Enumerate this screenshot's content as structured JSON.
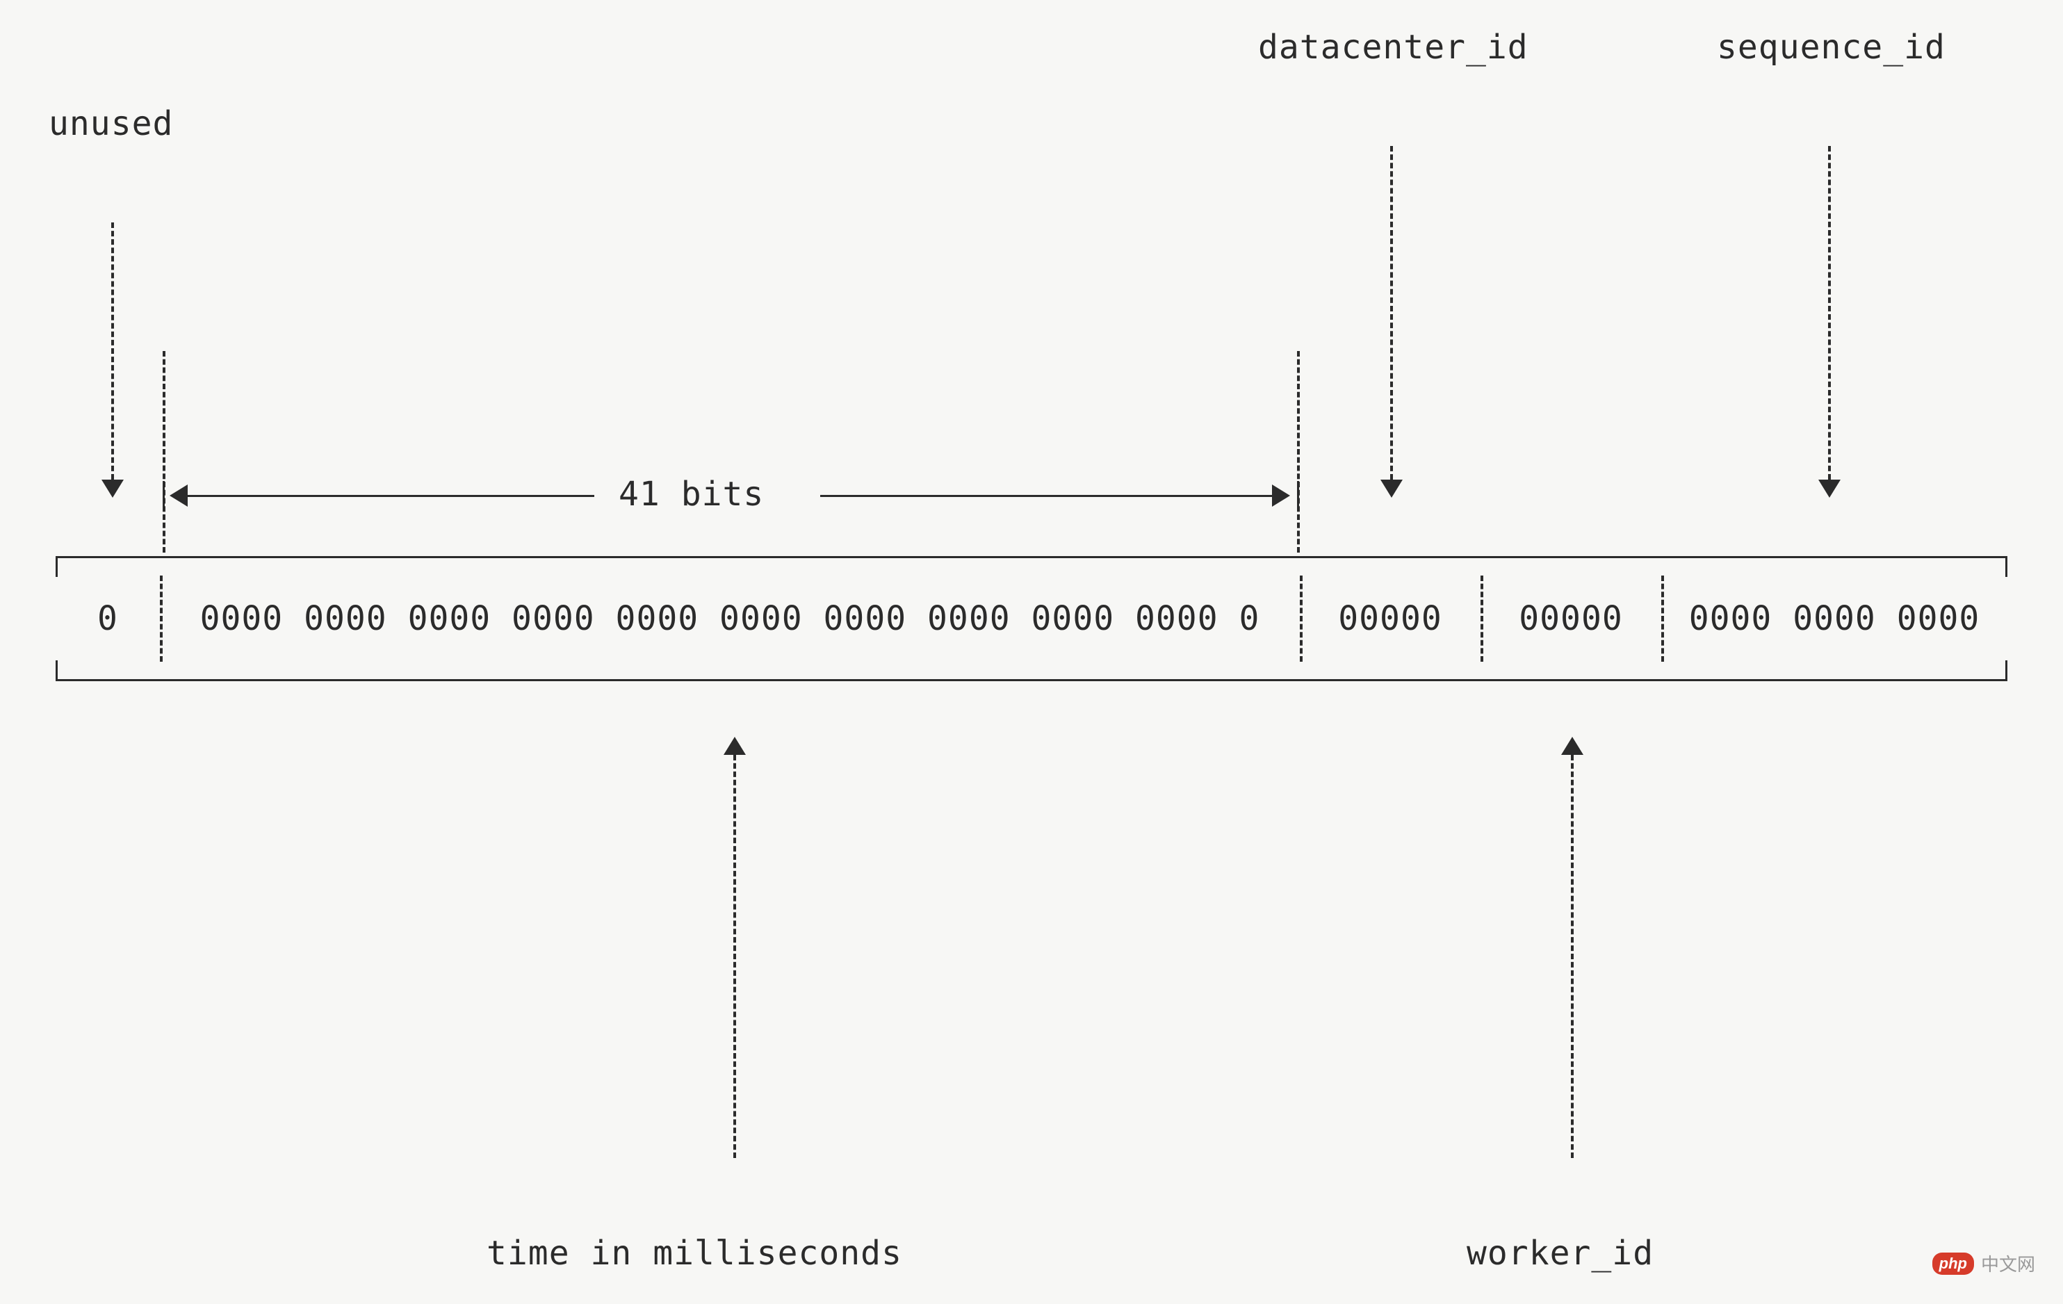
{
  "labels": {
    "unused": "unused",
    "datacenter_id": "datacenter_id",
    "sequence_id": "sequence_id",
    "time_in_ms": "time in milliseconds",
    "worker_id": "worker_id",
    "span_41_bits": "41 bits"
  },
  "cells": {
    "unused_bits": "0",
    "timestamp_bits": "0000 0000 0000 0000 0000 0000 0000 0000 0000 0000 0",
    "datacenter_bits": "00000",
    "worker_bits": "00000",
    "sequence_bits": "0000 0000 0000"
  },
  "watermark": {
    "logo": "php",
    "text": "中文网"
  }
}
